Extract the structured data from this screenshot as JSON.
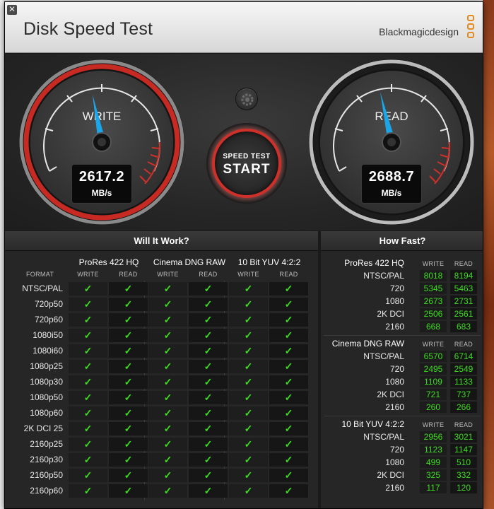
{
  "app": {
    "title": "Disk Speed Test",
    "brand": "Blackmagicdesign",
    "close_glyph": "✕"
  },
  "gauges": {
    "write": {
      "label": "WRITE",
      "value": "2617.2",
      "unit": "MB/s",
      "accent": "#d0302a"
    },
    "read": {
      "label": "READ",
      "value": "2688.7",
      "unit": "MB/s",
      "accent": "#d0302a"
    },
    "needle_color": "#1aa6e8"
  },
  "start_button": {
    "small": "SPEED TEST",
    "big": "START"
  },
  "settings_icon": "gear-icon",
  "will_it_work": {
    "title": "Will It Work?",
    "format_header": "FORMAT",
    "groups": [
      "ProRes 422 HQ",
      "Cinema DNG RAW",
      "10 Bit YUV 4:2:2"
    ],
    "sub_headers": [
      "WRITE",
      "READ"
    ],
    "check_glyph": "✓",
    "formats": [
      "NTSC/PAL",
      "720p50",
      "720p60",
      "1080i50",
      "1080i60",
      "1080p25",
      "1080p30",
      "1080p50",
      "1080p60",
      "2K DCI 25",
      "2160p25",
      "2160p30",
      "2160p50",
      "2160p60"
    ]
  },
  "how_fast": {
    "title": "How Fast?",
    "col_write": "WRITE",
    "col_read": "READ",
    "sections": [
      {
        "name": "ProRes 422 HQ",
        "rows": [
          {
            "format": "NTSC/PAL",
            "write": "8018",
            "read": "8194"
          },
          {
            "format": "720",
            "write": "5345",
            "read": "5463"
          },
          {
            "format": "1080",
            "write": "2673",
            "read": "2731"
          },
          {
            "format": "2K DCI",
            "write": "2506",
            "read": "2561"
          },
          {
            "format": "2160",
            "write": "668",
            "read": "683"
          }
        ]
      },
      {
        "name": "Cinema DNG RAW",
        "rows": [
          {
            "format": "NTSC/PAL",
            "write": "6570",
            "read": "6714"
          },
          {
            "format": "720",
            "write": "2495",
            "read": "2549"
          },
          {
            "format": "1080",
            "write": "1109",
            "read": "1133"
          },
          {
            "format": "2K DCI",
            "write": "721",
            "read": "737"
          },
          {
            "format": "2160",
            "write": "260",
            "read": "266"
          }
        ]
      },
      {
        "name": "10 Bit YUV 4:2:2",
        "rows": [
          {
            "format": "NTSC/PAL",
            "write": "2956",
            "read": "3021"
          },
          {
            "format": "720",
            "write": "1123",
            "read": "1147"
          },
          {
            "format": "1080",
            "write": "499",
            "read": "510"
          },
          {
            "format": "2K DCI",
            "write": "325",
            "read": "332"
          },
          {
            "format": "2160",
            "write": "117",
            "read": "120"
          }
        ]
      }
    ]
  },
  "colors": {
    "check": "#3ddc20",
    "logo": "#e58a1f"
  }
}
